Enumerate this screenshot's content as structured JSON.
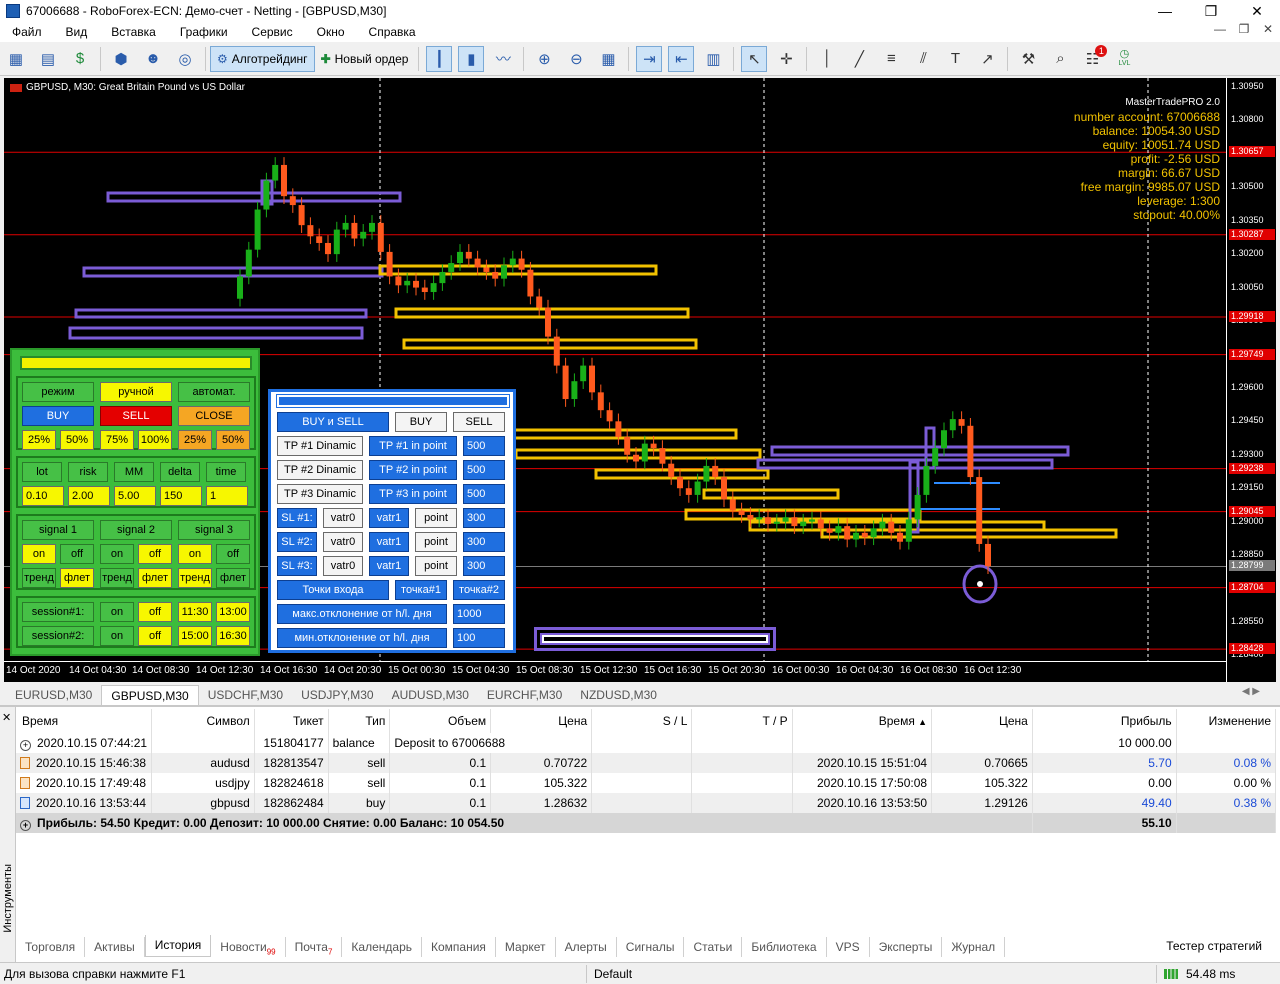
{
  "window": {
    "title": "67006688 - RoboForex-ECN: Демо-счет - Netting - [GBPUSD,M30]",
    "buttons": [
      "—",
      "❐",
      "✕"
    ]
  },
  "menu": [
    "Файл",
    "Вид",
    "Вставка",
    "Графики",
    "Сервис",
    "Окно",
    "Справка"
  ],
  "toolbar": {
    "algo_label": "Алготрейдинг",
    "new_order_label": "Новый ордер",
    "notification_badge": "1",
    "lvl_label": "LVL"
  },
  "chart": {
    "title": "GBPUSD, M30:  Great Britain Pound vs US Dollar",
    "price_labels": [
      "1.30950",
      "1.30800",
      "1.30650",
      "1.30500",
      "1.30350",
      "1.30200",
      "1.30050",
      "1.29900",
      "1.29750",
      "1.29600",
      "1.29450",
      "1.29300",
      "1.29150",
      "1.29000",
      "1.28850",
      "1.28700",
      "1.28550",
      "1.28400"
    ],
    "marked_prices": [
      {
        "label": "1.30657",
        "color": "#e00000"
      },
      {
        "label": "1.30287",
        "color": "#e00000"
      },
      {
        "label": "1.29918",
        "color": "#e00000"
      },
      {
        "label": "1.29749",
        "color": "#e00000"
      },
      {
        "label": "1.29238",
        "color": "#e00000"
      },
      {
        "label": "1.29045",
        "color": "#e00000"
      },
      {
        "label": "1.28799",
        "color": "#7a7a7a"
      },
      {
        "label": "1.28704",
        "color": "#e00000"
      },
      {
        "label": "1.28428",
        "color": "#e00000"
      }
    ],
    "time_labels": [
      "14 Oct 2020",
      "14 Oct 04:30",
      "14 Oct 08:30",
      "14 Oct 12:30",
      "14 Oct 16:30",
      "14 Oct 20:30",
      "15 Oct 00:30",
      "15 Oct 04:30",
      "15 Oct 08:30",
      "15 Oct 12:30",
      "15 Oct 16:30",
      "15 Oct 20:30",
      "16 Oct 00:30",
      "16 Oct 04:30",
      "16 Oct 08:30",
      "16 Oct 12:30"
    ],
    "colors": {
      "bull": "#19b019",
      "bear": "#ff5a1e",
      "yellow_zone": "#f2c200",
      "purple_zone": "#7b5cd6",
      "level": "#ff0000"
    }
  },
  "account": {
    "product": "MasterTradePRO 2.0",
    "lines": [
      "number account: 67006688",
      "balance: 10054.30 USD",
      "equity: 10051.74 USD",
      "profit: -2.56 USD",
      "margin: 66.67 USD",
      "free margin: 9985.07 USD",
      "leverage: 1:300",
      "stopout: 40.00%"
    ]
  },
  "left_panel": {
    "row1": [
      "режим",
      "ручной",
      "автомат."
    ],
    "row2": [
      "BUY",
      "SELL",
      "CLOSE"
    ],
    "row3": [
      "25%",
      "50%",
      "75%",
      "100%",
      "25%",
      "50%"
    ],
    "labels": [
      "lot",
      "risk",
      "MM",
      "delta",
      "time"
    ],
    "values": [
      "0.10",
      "2.00",
      "5.00",
      "150",
      "1"
    ],
    "signals": [
      "signal 1",
      "signal 2",
      "signal 3"
    ],
    "onoff": [
      "on",
      "off",
      "on",
      "off",
      "on",
      "off"
    ],
    "trend": [
      "тренд",
      "флет",
      "тренд",
      "флет",
      "тренд",
      "флет"
    ],
    "sessions": [
      {
        "label": "session#1:",
        "on": "on",
        "off": "off",
        "start": "11:30",
        "end": "13:00"
      },
      {
        "label": "session#2:",
        "on": "on",
        "off": "off",
        "start": "15:00",
        "end": "16:30"
      }
    ]
  },
  "right_panel": {
    "top": [
      "BUY и SELL",
      "BUY",
      "SELL"
    ],
    "tp": [
      {
        "label": "TP #1 Dinamic",
        "point": "TP #1 in point",
        "value": "500"
      },
      {
        "label": "TP #2 Dinamic",
        "point": "TP #2 in point",
        "value": "500"
      },
      {
        "label": "TP #3 Dinamic",
        "point": "TP #3 in point",
        "value": "500"
      }
    ],
    "sl": [
      {
        "label": "SL #1:",
        "v0": "vatr0",
        "v1": "vatr1",
        "pt": "point",
        "value": "300"
      },
      {
        "label": "SL #2:",
        "v0": "vatr0",
        "v1": "vatr1",
        "pt": "point",
        "value": "300"
      },
      {
        "label": "SL #3:",
        "v0": "vatr0",
        "v1": "vatr1",
        "pt": "point",
        "value": "300"
      }
    ],
    "entry": [
      "Точки входа",
      "точка#1",
      "точка#2"
    ],
    "max_dev": {
      "label": "макс.отклонение от h/l. дня",
      "value": "1000"
    },
    "min_dev": {
      "label": "мин.отклонение от h/l. дня",
      "value": "100"
    }
  },
  "symbol_tabs": [
    "EURUSD,M30",
    "GBPUSD,M30",
    "USDCHF,M30",
    "USDJPY,M30",
    "AUDUSD,M30",
    "EURCHF,M30",
    "NZDUSD,M30"
  ],
  "history": {
    "headers": [
      "Время",
      "Символ",
      "Тикет",
      "Тип",
      "Объем",
      "Цена",
      "S / L",
      "T / P",
      "Время",
      "Цена",
      "Прибыль",
      "Изменение"
    ],
    "rows": [
      {
        "time": "2020.10.15 07:44:21",
        "symbol": "",
        "ticket": "151804177",
        "type": "balance",
        "volume": "Deposit to 67006688",
        "price": "",
        "sl": "",
        "tp": "",
        "time2": "",
        "price2": "",
        "profit": "10 000.00",
        "change": ""
      },
      {
        "time": "2020.10.15 15:46:38",
        "symbol": "audusd",
        "ticket": "182813547",
        "type": "sell",
        "volume": "0.1",
        "price": "0.70722",
        "sl": "",
        "tp": "",
        "time2": "2020.10.15 15:51:04",
        "price2": "0.70665",
        "profit": "5.70",
        "change": "0.08 %"
      },
      {
        "time": "2020.10.15 17:49:48",
        "symbol": "usdjpy",
        "ticket": "182824618",
        "type": "sell",
        "volume": "0.1",
        "price": "105.322",
        "sl": "",
        "tp": "",
        "time2": "2020.10.15 17:50:08",
        "price2": "105.322",
        "profit": "0.00",
        "change": "0.00 %"
      },
      {
        "time": "2020.10.16 13:53:44",
        "symbol": "gbpusd",
        "ticket": "182862484",
        "type": "buy",
        "volume": "0.1",
        "price": "1.28632",
        "sl": "",
        "tp": "",
        "time2": "2020.10.16 13:53:50",
        "price2": "1.29126",
        "profit": "49.40",
        "change": "0.38 %"
      }
    ],
    "total_label": "Прибыль: 54.50  Кредит: 0.00  Депозит: 10 000.00  Снятие: 0.00  Баланс: 10 054.50",
    "total_value": "55.10"
  },
  "terminal_label": "Инструменты",
  "terminal_tabs": [
    {
      "label": "Торговля",
      "badge": ""
    },
    {
      "label": "Активы",
      "badge": ""
    },
    {
      "label": "История",
      "badge": ""
    },
    {
      "label": "Новости",
      "badge": "99"
    },
    {
      "label": "Почта",
      "badge": "7"
    },
    {
      "label": "Календарь",
      "badge": ""
    },
    {
      "label": "Компания",
      "badge": ""
    },
    {
      "label": "Маркет",
      "badge": ""
    },
    {
      "label": "Алерты",
      "badge": ""
    },
    {
      "label": "Сигналы",
      "badge": ""
    },
    {
      "label": "Статьи",
      "badge": ""
    },
    {
      "label": "Библиотека",
      "badge": ""
    },
    {
      "label": "VPS",
      "badge": ""
    },
    {
      "label": "Эксперты",
      "badge": ""
    },
    {
      "label": "Журнал",
      "badge": ""
    }
  ],
  "tester_label": "Тестер стратегий",
  "status": {
    "help": "Для вызова справки нажмите F1",
    "profile": "Default",
    "ping": "54.48 ms"
  }
}
